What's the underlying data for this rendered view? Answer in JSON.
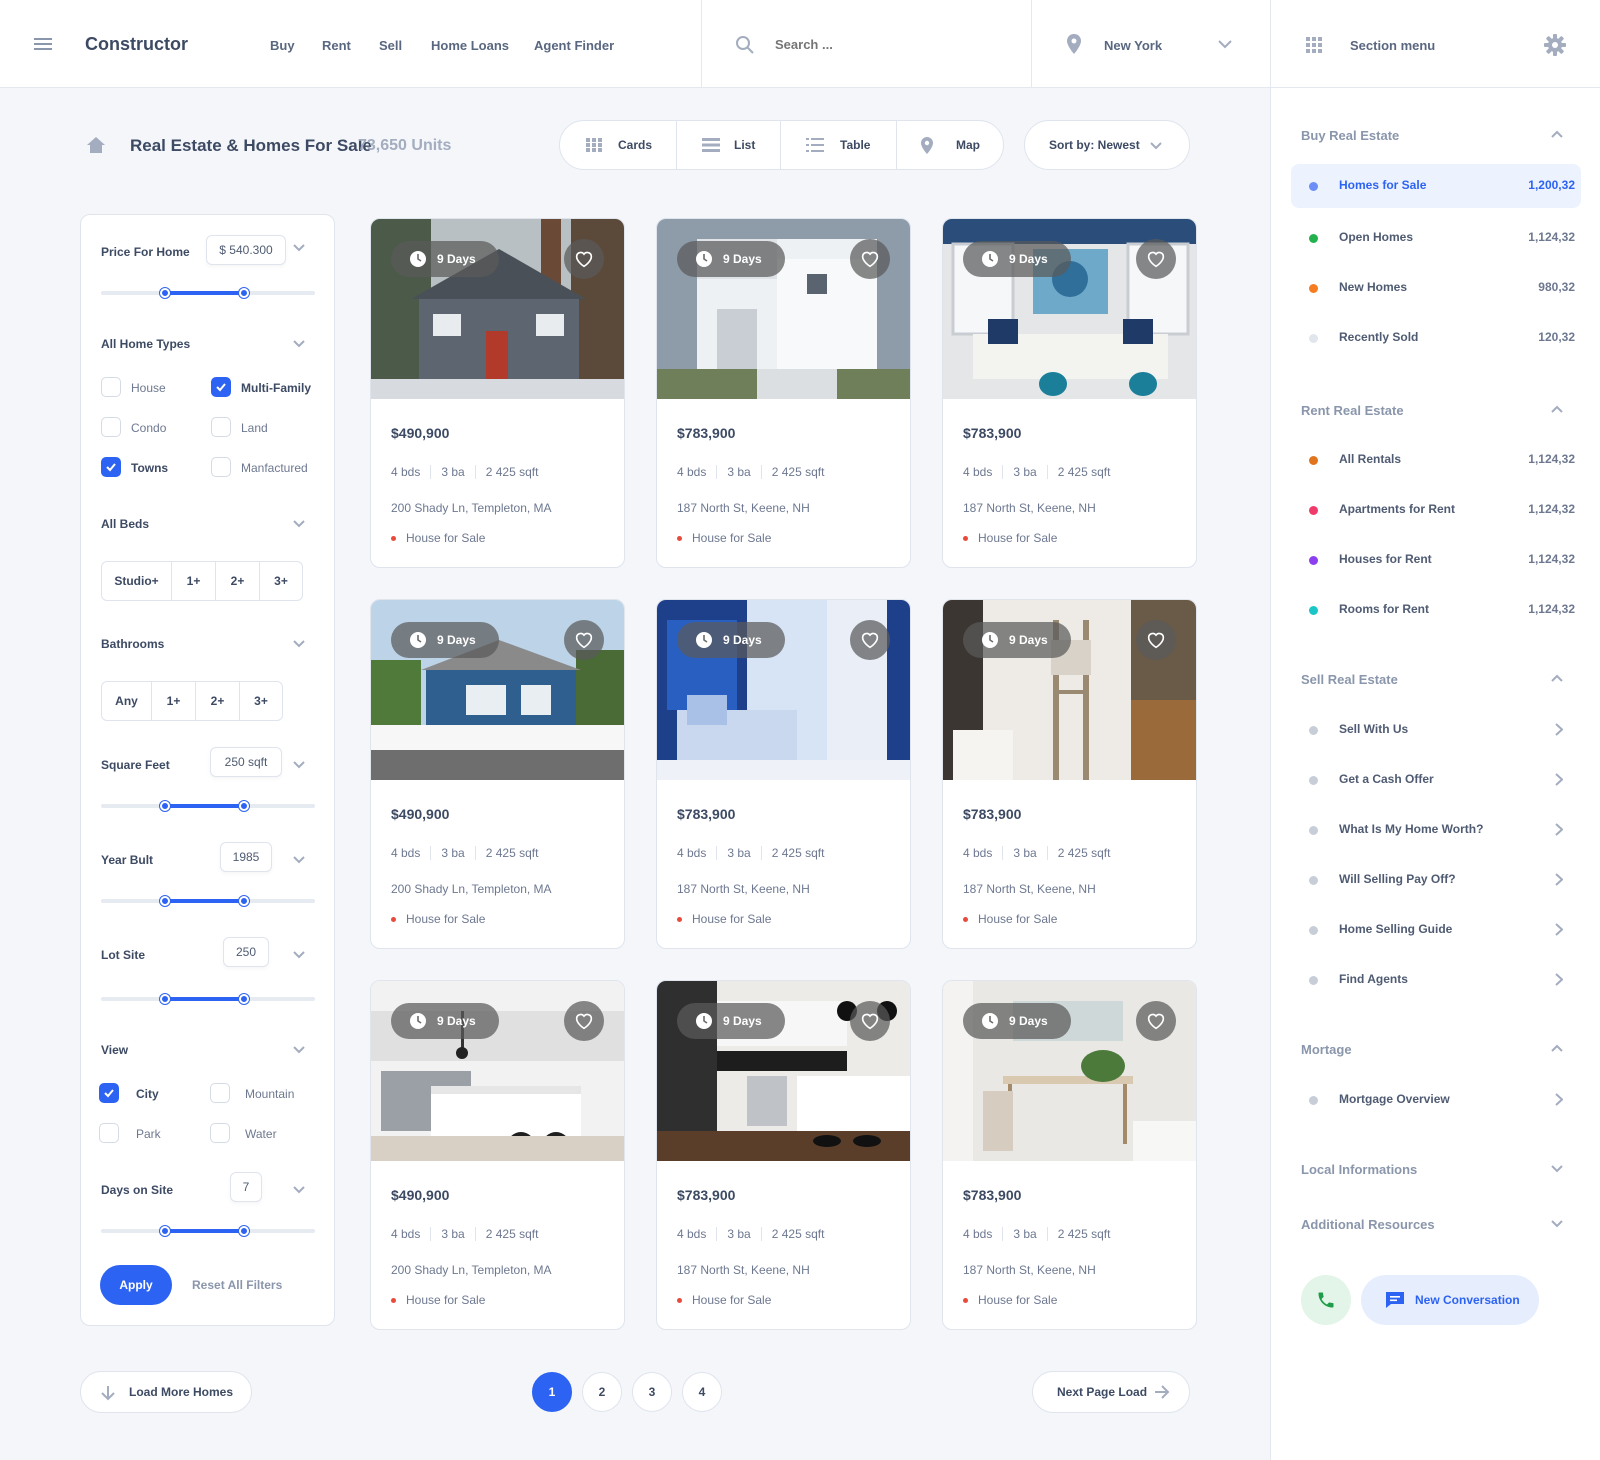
{
  "header": {
    "brand": "Constructor",
    "nav": [
      "Buy",
      "Rent",
      "Sell",
      "Home Loans",
      "Agent Finder"
    ],
    "search_placeholder": "Search ...",
    "location": "New York",
    "section_menu": "Section menu"
  },
  "page": {
    "title": "Real Estate & Homes For Sale",
    "units": "73,650 Units"
  },
  "views": [
    "Cards",
    "List",
    "Table",
    "Map"
  ],
  "sort_label": "Sort by: Newest",
  "filters": {
    "price": {
      "label": "Price For Home",
      "value": "$ 540.300",
      "range": [
        0.3,
        0.67
      ]
    },
    "home_types": {
      "label": "All Home Types",
      "options": [
        {
          "label": "House",
          "checked": false
        },
        {
          "label": "Multi-Family",
          "checked": true
        },
        {
          "label": "Condo",
          "checked": false
        },
        {
          "label": "Land",
          "checked": false
        },
        {
          "label": "Towns",
          "checked": true
        },
        {
          "label": "Manfactured",
          "checked": false
        }
      ]
    },
    "beds": {
      "label": "All Beds",
      "options": [
        "Studio+",
        "1+",
        "2+",
        "3+"
      ]
    },
    "baths": {
      "label": "Bathrooms",
      "options": [
        "Any",
        "1+",
        "2+",
        "3+"
      ]
    },
    "sqft": {
      "label": "Square Feet",
      "value": "250 sqft",
      "range": [
        0.3,
        0.67
      ]
    },
    "year": {
      "label": "Year Bult",
      "value": "1985",
      "range": [
        0.3,
        0.67
      ]
    },
    "lot": {
      "label": "Lot Site",
      "value": "250",
      "range": [
        0.3,
        0.67
      ]
    },
    "view": {
      "label": "View",
      "options": [
        {
          "label": "City",
          "checked": true
        },
        {
          "label": "Mountain",
          "checked": false
        },
        {
          "label": "Park",
          "checked": false
        },
        {
          "label": "Water",
          "checked": false
        }
      ]
    },
    "days": {
      "label": "Days on Site",
      "value": "7",
      "range": [
        0.3,
        0.67
      ]
    },
    "apply": "Apply",
    "reset": "Reset All Filters"
  },
  "listings": [
    {
      "days": "9 Days",
      "price": "$490,900",
      "beds": "4 bds",
      "baths": "3 ba",
      "sqft": "2 425 sqft",
      "address": "200 Shady Ln, Templeton, MA",
      "status": "House for Sale"
    },
    {
      "days": "9 Days",
      "price": "$783,900",
      "beds": "4 bds",
      "baths": "3 ba",
      "sqft": "2 425 sqft",
      "address": "187 North St, Keene, NH",
      "status": "House for Sale"
    },
    {
      "days": "9 Days",
      "price": "$783,900",
      "beds": "4 bds",
      "baths": "3 ba",
      "sqft": "2 425 sqft",
      "address": "187 North St, Keene, NH",
      "status": "House for Sale"
    },
    {
      "days": "9 Days",
      "price": "$490,900",
      "beds": "4 bds",
      "baths": "3 ba",
      "sqft": "2 425 sqft",
      "address": "200 Shady Ln, Templeton, MA",
      "status": "House for Sale"
    },
    {
      "days": "9 Days",
      "price": "$783,900",
      "beds": "4 bds",
      "baths": "3 ba",
      "sqft": "2 425 sqft",
      "address": "187 North St, Keene, NH",
      "status": "House for Sale"
    },
    {
      "days": "9 Days",
      "price": "$783,900",
      "beds": "4 bds",
      "baths": "3 ba",
      "sqft": "2 425 sqft",
      "address": "187 North St, Keene, NH",
      "status": "House for Sale"
    },
    {
      "days": "9 Days",
      "price": "$490,900",
      "beds": "4 bds",
      "baths": "3 ba",
      "sqft": "2 425 sqft",
      "address": "200 Shady Ln, Templeton, MA",
      "status": "House for Sale"
    },
    {
      "days": "9 Days",
      "price": "$783,900",
      "beds": "4 bds",
      "baths": "3 ba",
      "sqft": "2 425 sqft",
      "address": "187 North St, Keene, NH",
      "status": "House for Sale"
    },
    {
      "days": "9 Days",
      "price": "$783,900",
      "beds": "4 bds",
      "baths": "3 ba",
      "sqft": "2 425 sqft",
      "address": "187 North St, Keene, NH",
      "status": "House for Sale"
    }
  ],
  "pagination": {
    "load_more": "Load More Homes",
    "pages": [
      "1",
      "2",
      "3",
      "4"
    ],
    "current": "1",
    "next": "Next Page Load"
  },
  "sidebar": {
    "buy": {
      "title": "Buy Real Estate",
      "items": [
        {
          "label": "Homes for Sale",
          "count": "1,200,32",
          "color": "#6c8ef5",
          "active": true
        },
        {
          "label": "Open Homes",
          "count": "1,124,32",
          "color": "#22b14c"
        },
        {
          "label": "New Homes",
          "count": "980,32",
          "color": "#f57c20"
        },
        {
          "label": "Recently Sold",
          "count": "120,32",
          "color": "#e1e5ec"
        }
      ]
    },
    "rent": {
      "title": "Rent Real Estate",
      "items": [
        {
          "label": "All Rentals",
          "count": "1,124,32",
          "color": "#e1741f"
        },
        {
          "label": "Apartments for Rent",
          "count": "1,124,32",
          "color": "#f03a6a"
        },
        {
          "label": "Houses for Rent",
          "count": "1,124,32",
          "color": "#8b3ff0"
        },
        {
          "label": "Rooms for Rent",
          "count": "1,124,32",
          "color": "#1cc6c6"
        }
      ]
    },
    "sell": {
      "title": "Sell Real Estate",
      "items": [
        "Sell With Us",
        "Get a Cash Offer",
        "What Is My Home Worth?",
        "Will Selling Pay Off?",
        "Home Selling Guide",
        "Find Agents"
      ]
    },
    "mortgage": {
      "title": "Mortage",
      "items": [
        "Mortgage Overview"
      ]
    },
    "local": "Local Informations",
    "additional": "Additional Resources",
    "new_conversation": "New Conversation"
  }
}
